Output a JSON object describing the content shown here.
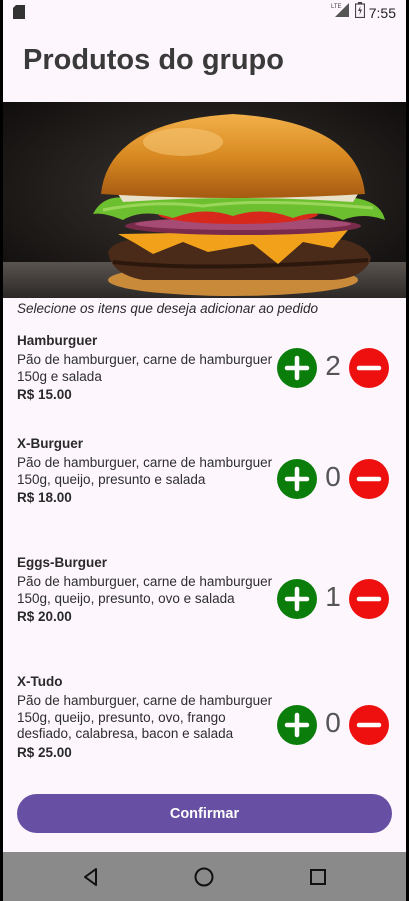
{
  "status_bar": {
    "time": "7:55",
    "network": "LTE",
    "icons": [
      "sd-card-icon",
      "lte-signal-icon",
      "battery-icon"
    ]
  },
  "page": {
    "title": "Produtos do grupo",
    "hint": "Selecione os itens que deseja adicionar ao pedido"
  },
  "products": [
    {
      "name": "Hamburguer",
      "description": "Pão de hamburguer, carne de hamburguer 150g e salada",
      "price": "R$ 15.00",
      "quantity": "2"
    },
    {
      "name": "X-Burguer",
      "description": "Pão de hamburguer, carne de hamburguer 150g, queijo, presunto e salada",
      "price": "R$ 18.00",
      "quantity": "0"
    },
    {
      "name": "Eggs-Burguer",
      "description": "Pão de hamburguer, carne de hamburguer 150g, queijo, presunto, ovo e salada",
      "price": "R$ 20.00",
      "quantity": "1"
    },
    {
      "name": "X-Tudo",
      "description": "Pão de hamburguer, carne de hamburguer 150g, queijo, presunto, ovo, frango desfiado, calabresa, bacon e salada",
      "price": "R$ 25.00",
      "quantity": "0"
    }
  ],
  "actions": {
    "confirm_label": "Confirmar"
  },
  "colors": {
    "add": "#0b7d0b",
    "remove": "#ee0f0f",
    "primary": "#6750a4"
  }
}
